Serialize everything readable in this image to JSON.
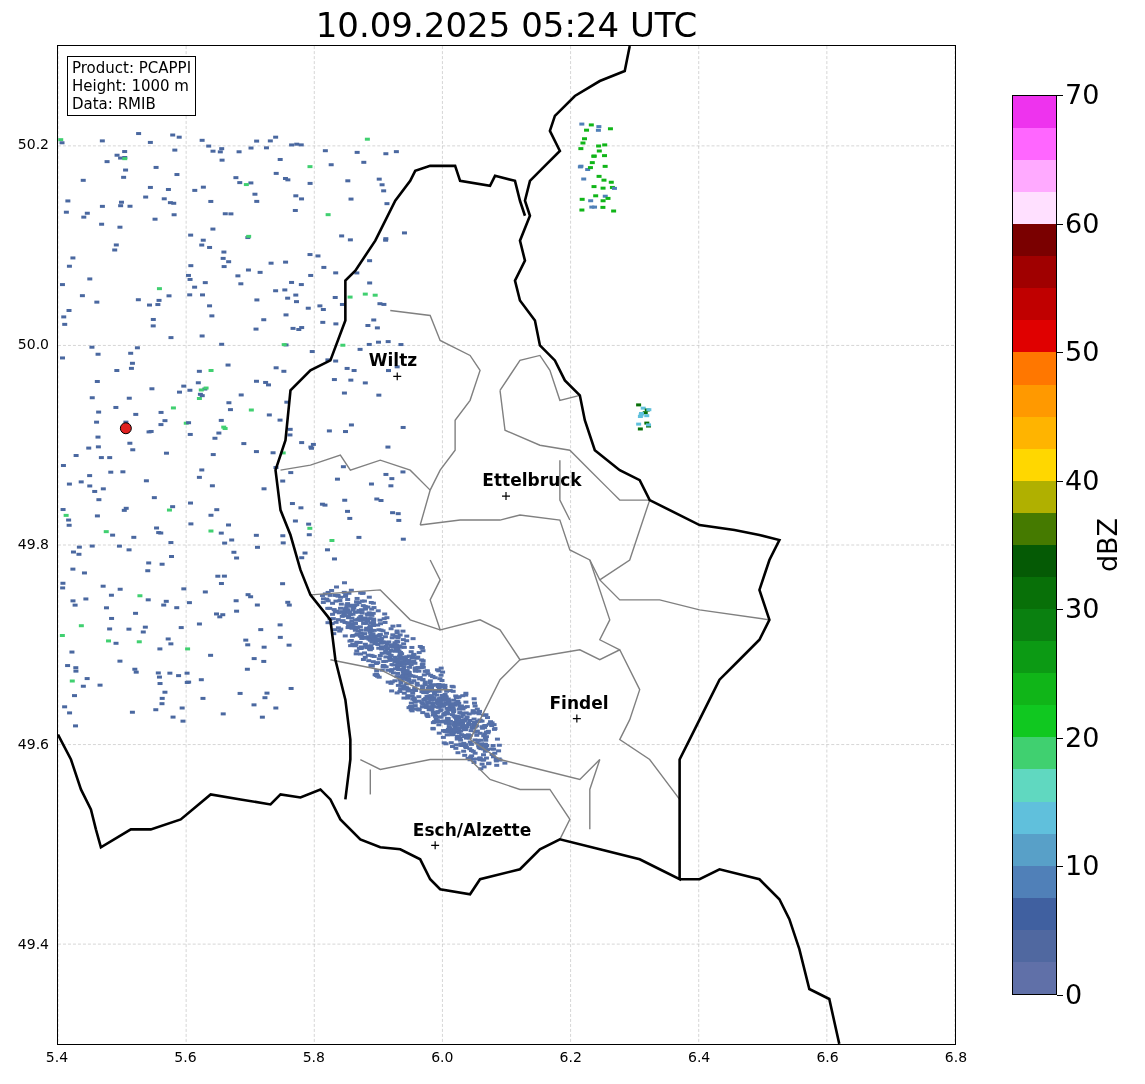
{
  "title": "10.09.2025 05:24 UTC",
  "legend": [
    "Product: PCAPPI",
    "Height: 1000 m",
    "Data: RMIB"
  ],
  "x_ticks": [
    "5.4",
    "5.6",
    "5.8",
    "6.0",
    "6.2",
    "6.4",
    "6.6",
    "6.8"
  ],
  "y_ticks": [
    "50.2",
    "50.0",
    "49.8",
    "49.6",
    "49.4"
  ],
  "places": [
    {
      "name": "Wiltz"
    },
    {
      "name": "Ettelbruck"
    },
    {
      "name": "Findel"
    },
    {
      "name": "Esch/Alzette"
    }
  ],
  "colorbar": {
    "label": "dBZ",
    "ticks": [
      "70",
      "60",
      "50",
      "40",
      "30",
      "20",
      "10",
      "0"
    ],
    "bands": [
      {
        "color": "#6070a8"
      },
      {
        "color": "#5068a0"
      },
      {
        "color": "#4060a0"
      },
      {
        "color": "#5080b8"
      },
      {
        "color": "#58a0c8"
      },
      {
        "color": "#60c0dc"
      },
      {
        "color": "#60d8c0"
      },
      {
        "color": "#40d070"
      },
      {
        "color": "#10c820"
      },
      {
        "color": "#10b518"
      },
      {
        "color": "#0c9a14"
      },
      {
        "color": "#0a8010"
      },
      {
        "color": "#087008"
      },
      {
        "color": "#055a05"
      },
      {
        "color": "#457a00"
      },
      {
        "color": "#b0b000"
      },
      {
        "color": "#ffd700"
      },
      {
        "color": "#ffb400"
      },
      {
        "color": "#ff9900"
      },
      {
        "color": "#ff7700"
      },
      {
        "color": "#e00000"
      },
      {
        "color": "#c00000"
      },
      {
        "color": "#a00000"
      },
      {
        "color": "#7a0000"
      },
      {
        "color": "#ffe0ff"
      },
      {
        "color": "#ffaaff"
      },
      {
        "color": "#ff66ff"
      },
      {
        "color": "#ee33ee"
      }
    ]
  }
}
